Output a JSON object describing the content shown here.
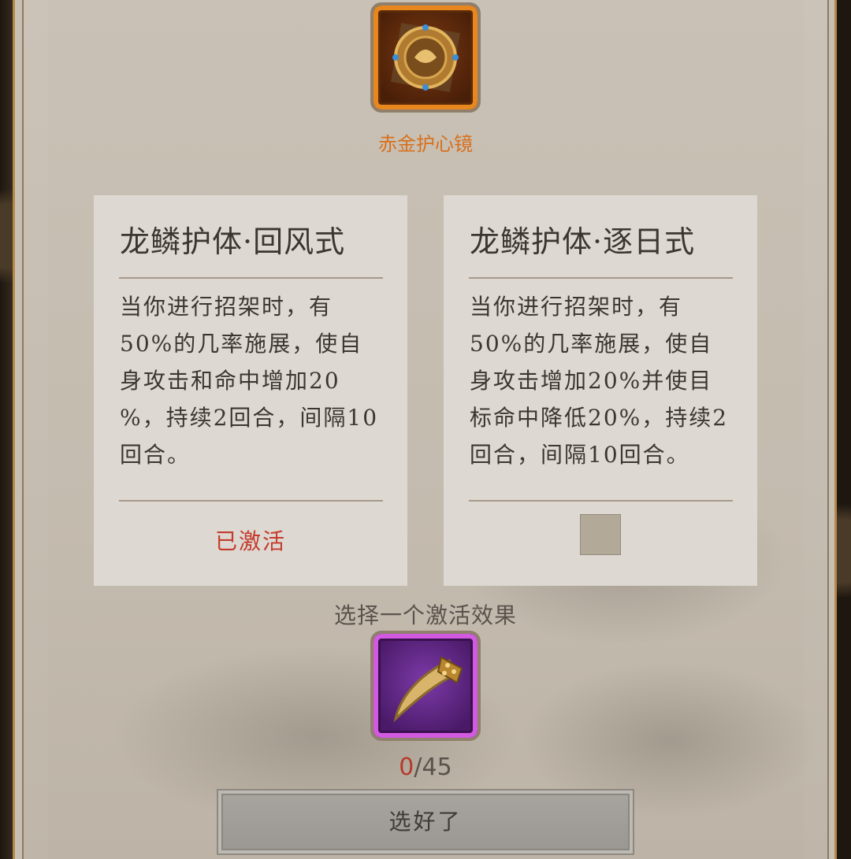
{
  "item_top": {
    "name": "赤金护心镜",
    "icon": "gold-heart-mirror-icon",
    "border_color": "#e8871e"
  },
  "cards": [
    {
      "title": "龙鳞护体·回风式",
      "desc_lines": [
        "当你进行招架时，有",
        "50%的几率施展，使自",
        "身攻击和命中增加20",
        "%，持续2回合，间隔10",
        "回合。"
      ],
      "status": "已激活"
    },
    {
      "title": "龙鳞护体·逐日式",
      "desc_lines": [
        "当你进行招架时，有",
        "50%的几率施展，使自",
        "身攻击增加20%并使目",
        "标命中降低20%，持续2",
        "回合，间隔10回合。"
      ],
      "selected": false
    }
  ],
  "prompt": "选择一个激活效果",
  "item_bottom": {
    "icon": "golden-claw-icon",
    "border_color": "#d25ae0"
  },
  "counter": {
    "current": "0",
    "separator": "/",
    "total": "45"
  },
  "confirm_label": "选好了",
  "colors": {
    "active_status": "#c43b2b",
    "item_name": "#d86f1c"
  }
}
